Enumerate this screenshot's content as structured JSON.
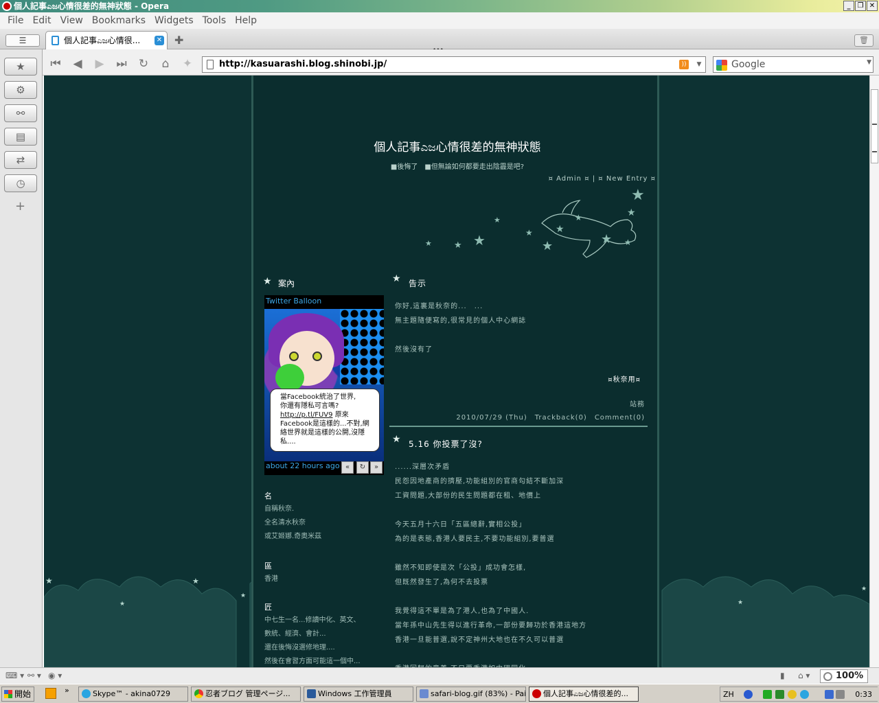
{
  "window": {
    "title": "個人記事ಎಜ心情很差的無神狀態 - Opera"
  },
  "menu": [
    "File",
    "Edit",
    "View",
    "Bookmarks",
    "Widgets",
    "Tools",
    "Help"
  ],
  "tab": {
    "label": "個人記事ಎಜ心情很..."
  },
  "address": {
    "url": "http://kasuarashi.blog.shinobi.jp/"
  },
  "search": {
    "placeholder": "Google"
  },
  "blog": {
    "title": "個人記事ಎಜ心情很差的無神狀態",
    "subtitle": "■後悔了　■但無論如何都要走出陰霾是吧?",
    "nav": {
      "admin": "¤ Admin",
      "sep": "¤ | ¤",
      "new_entry": "New Entry",
      "end": "¤"
    },
    "sidebar": {
      "guide_heading": "案內",
      "twitter": {
        "title": "Twitter Balloon",
        "bubble_line1": "當Facebook統治了世界,",
        "bubble_line2": "你還有隱私可言嗎?",
        "bubble_link": "http://p.tl/FUV9",
        "bubble_line3": " 原來Facebook是這樣的...不對,網絡世界就是這樣的公開,沒隱私....",
        "time": "about 22 hours ago",
        "prev": "«",
        "refresh": "↻",
        "next": "»"
      },
      "name_heading": "名",
      "name_lines": [
        "自稱秋奈.",
        "全名清水秋奈",
        "或艾姬娜.奇奧米茲"
      ],
      "district_heading": "區",
      "district_lines": [
        "香港"
      ],
      "grade_heading": "匠",
      "grade_lines": [
        "中七生一名...修讀中化、英文、",
        "數統、經濟、會計...",
        "還在後悔沒選修地理....",
        "然後在會習方面可能這一個中..."
      ]
    },
    "post1": {
      "heading": "告示",
      "lines": [
        "你好,這裏是秋奈的...　...",
        "無主題隨便寫的,很常見的個人中心網誌",
        "",
        "然後沒有了"
      ],
      "sign": "¤秋奈用¤",
      "cat": "站務",
      "meta": "2010/07/29 (Thu)　Trackback(0)　Comment(0)"
    },
    "post2": {
      "heading": "5.16 你投票了沒?",
      "lines": [
        "......深層次矛盾",
        "民怨因地產商的擠壓,功能組別的官商勾結不斷加深",
        "工資問題,大部份的民生問題都在租、地價上",
        "",
        "今天五月十六日「五區總辭,實相公投」",
        "為的是表態,香港人要民主,不要功能組別,要普選",
        "",
        "雖然不知即使是次「公投」成功會怎樣,",
        "但既然發生了,為何不去投票",
        "",
        "我覺得這不單是為了港人,也為了中國人.",
        "當年孫中山先生得以進行革命,一部份要歸功於香港這地方",
        "香港一旦能普選,說不定神州大地也在不久可以普選",
        "",
        "香港回歸的意義,不只要香港如中國同化..."
      ]
    }
  },
  "status": {
    "zoom": "100%"
  },
  "taskbar": {
    "start": "開始",
    "chevron": "»",
    "tasks": [
      "Skype™ - akina0729",
      "忍者ブログ 管理ページ...",
      "Windows 工作管理員",
      "safari-blog.gif (83%) - Pai...",
      "個人記事ಎಜ心情很差的..."
    ],
    "lang": "ZH",
    "clock": "0:33"
  },
  "colors": {
    "page_bg": "#0d3233",
    "column_bg": "#0b2d2e",
    "accent": "#2b8fd6"
  }
}
